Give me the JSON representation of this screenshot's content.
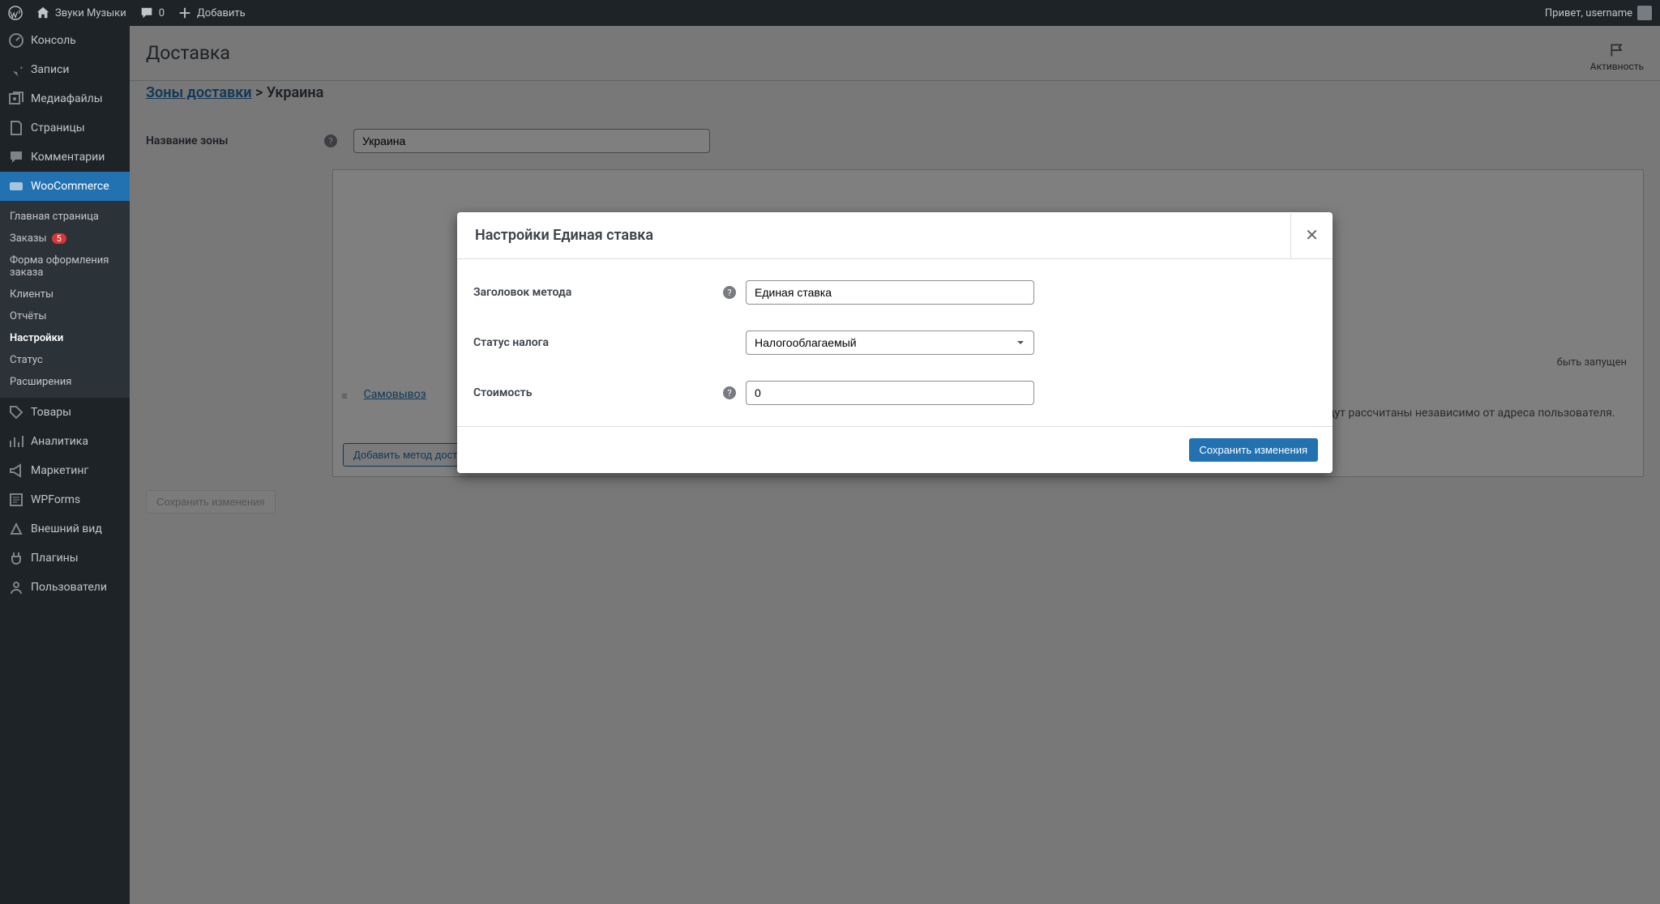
{
  "adminbar": {
    "site_name": "Звуки Музыки",
    "comments": "0",
    "add_new": "Добавить",
    "greeting": "Привет, username"
  },
  "sidebar": {
    "items": [
      {
        "label": "Консоль"
      },
      {
        "label": "Записи"
      },
      {
        "label": "Медиафайлы"
      },
      {
        "label": "Страницы"
      },
      {
        "label": "Комментарии"
      },
      {
        "label": "WooCommerce"
      },
      {
        "label": "Товары"
      },
      {
        "label": "Аналитика"
      },
      {
        "label": "Маркетинг"
      },
      {
        "label": "WPForms"
      },
      {
        "label": "Внешний вид"
      },
      {
        "label": "Плагины"
      },
      {
        "label": "Пользователи"
      }
    ],
    "woo_submenu": [
      {
        "label": "Главная страница"
      },
      {
        "label": "Заказы",
        "badge": "5"
      },
      {
        "label": "Форма оформления заказа"
      },
      {
        "label": "Клиенты"
      },
      {
        "label": "Отчёты"
      },
      {
        "label": "Настройки"
      },
      {
        "label": "Статус"
      },
      {
        "label": "Расширения"
      }
    ]
  },
  "page": {
    "title": "Доставка",
    "activity": "Активность",
    "breadcrumb_link": "Зоны доставки",
    "breadcrumb_sep": " > ",
    "breadcrumb_current": "Украина",
    "zone_name_label": "Название зоны",
    "zone_name_value": "Украина",
    "shipping_method": {
      "name": "Самовывоз",
      "title": "Самовывоз",
      "desc": "Позволить клиентам забирать заказы самостоятельно. По умолчанию, при использовании самовывоза, базовые налоги будут рассчитаны независимо от адреса пользователя."
    },
    "hidden_text": "быть запущен",
    "add_method_btn": "Добавить метод доставки",
    "save_btn": "Сохранить изменения"
  },
  "modal": {
    "title": "Настройки Единая ставка",
    "fields": {
      "method_title_label": "Заголовок метода",
      "method_title_value": "Единая ставка",
      "tax_status_label": "Статус налога",
      "tax_status_value": "Налогооблагаемый",
      "cost_label": "Стоимость",
      "cost_value": "0"
    },
    "save_btn": "Сохранить изменения"
  }
}
